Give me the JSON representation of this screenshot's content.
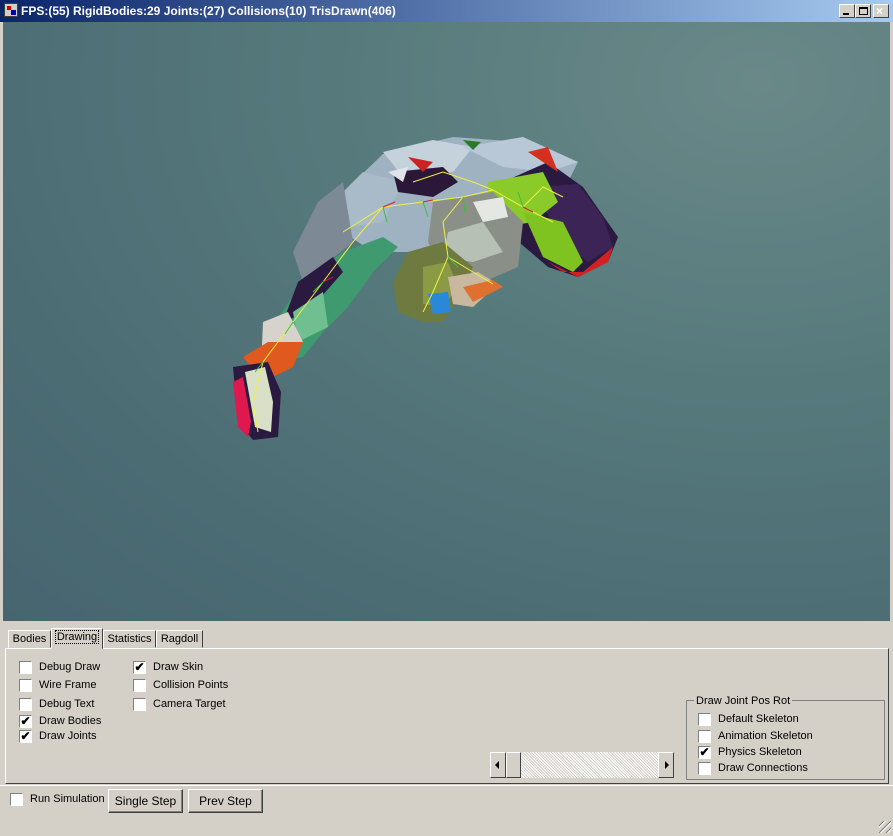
{
  "window": {
    "title": "FPS:(55) RigidBodies:29 Joints:(27) Collisions(10) TrisDrawn(406)",
    "icon": "app-icon",
    "controls": [
      "minimize",
      "maximize",
      "close"
    ]
  },
  "viewport": {
    "background_color": "#557478",
    "content": "ragdoll-physics-scene"
  },
  "tabs": [
    {
      "label": "Bodies",
      "active": false
    },
    {
      "label": "Drawing",
      "active": true
    },
    {
      "label": "Statistics",
      "active": false
    },
    {
      "label": "Ragdoll",
      "active": false
    }
  ],
  "drawing": {
    "left_column": [
      {
        "label": "Debug Draw",
        "checked": false
      },
      {
        "label": "Wire Frame",
        "checked": false
      },
      {
        "label": "Debug Text",
        "checked": false
      },
      {
        "label": "Draw Bodies",
        "checked": true
      },
      {
        "label": "Draw Joints",
        "checked": true
      }
    ],
    "right_column": [
      {
        "label": "Draw Skin",
        "checked": true
      },
      {
        "label": "Collision Points",
        "checked": false
      },
      {
        "label": "Camera Target",
        "checked": false
      }
    ],
    "joint_group": {
      "title": "Draw Joint Pos Rot",
      "items": [
        {
          "label": "Default Skeleton",
          "checked": false
        },
        {
          "label": "Animation Skeleton",
          "checked": false
        },
        {
          "label": "Physics Skeleton",
          "checked": true
        },
        {
          "label": "Draw Connections",
          "checked": false
        }
      ]
    },
    "scrollbar": {
      "position_fraction": 0.0
    }
  },
  "bottom": {
    "run_simulation": {
      "label": "Run Simulation",
      "checked": false
    },
    "single_step_label": "Single Step",
    "prev_step_label": "Prev Step"
  },
  "check_glyph": "✔"
}
